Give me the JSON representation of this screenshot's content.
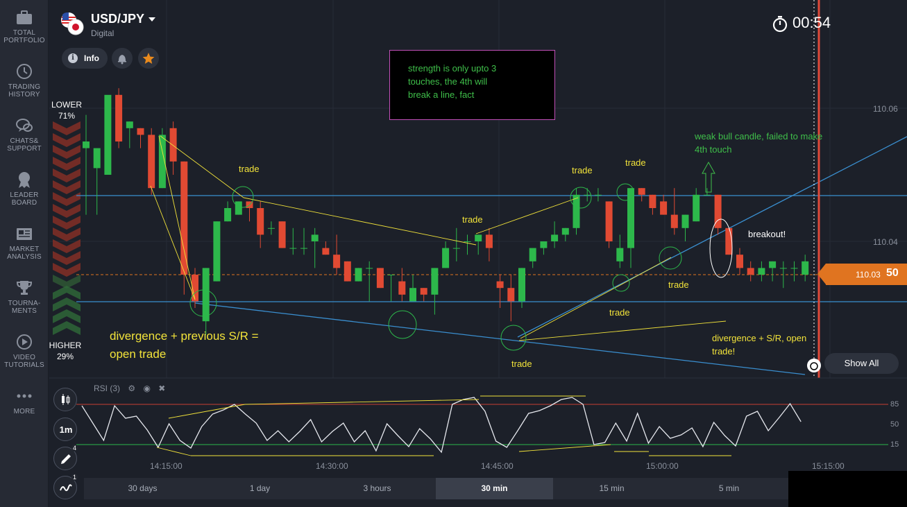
{
  "asset": {
    "name": "USD/JPY",
    "type": "Digital"
  },
  "info_label": "Info",
  "timer": "00:54",
  "sidebar": [
    {
      "label": "TOTAL\nPORTFOLIO",
      "icon": "briefcase-icon"
    },
    {
      "label": "TRADING\nHISTORY",
      "icon": "history-icon"
    },
    {
      "label": "CHATS&\nSUPPORT",
      "icon": "chat-icon"
    },
    {
      "label": "LEADER\nBOARD",
      "icon": "medal-icon"
    },
    {
      "label": "MARKET\nANALYSIS",
      "icon": "newspaper-icon"
    },
    {
      "label": "TOURNA-\nMENTS",
      "icon": "trophy-icon"
    },
    {
      "label": "VIDEO\nTUTORIALS",
      "icon": "play-icon"
    },
    {
      "label": "MORE",
      "icon": "more-dots-icon"
    }
  ],
  "sentiment": {
    "lower_label": "LOWER",
    "lower_pct": "71%",
    "higher_label": "HIGHER",
    "higher_pct": "29%"
  },
  "y_axis": [
    "110.06",
    "110.04"
  ],
  "current_price": {
    "main": "110.03",
    "emph": "50"
  },
  "x_axis": [
    "14:15:00",
    "14:30:00",
    "14:45:00",
    "15:00:00",
    "15:15:00"
  ],
  "rsi": {
    "label": "RSI (3)",
    "levels": [
      "85",
      "50",
      "15"
    ]
  },
  "tools": [
    {
      "text": "",
      "icon": "candles-icon",
      "badge": ""
    },
    {
      "text": "1m",
      "icon": "",
      "badge": ""
    },
    {
      "text": "",
      "icon": "pencil-icon",
      "badge": "4"
    },
    {
      "text": "",
      "icon": "wave-icon",
      "badge": "1"
    }
  ],
  "show_all": "Show All",
  "timeframes": [
    "30 days",
    "1 day",
    "3 hours",
    "30 min",
    "15 min",
    "5 min"
  ],
  "active_timeframe": "30 min",
  "note": "strength is only upto 3\ntouches, the 4th will\nbreak a line, fact",
  "annotations": {
    "trade1": "trade",
    "trade2": "trade",
    "trade3": "trade",
    "trade4": "trade",
    "trade5": "trade",
    "trade6": "trade",
    "trade7": "trade",
    "trade8": "trade",
    "divergence_big": "divergence + previous S/R =\nopen trade",
    "weak_bull": "weak bull candle, failed to make\n4th touch",
    "breakout": "breakout!",
    "divergence_small": "divergence + S/R, open\ntrade!"
  },
  "colors": {
    "bull": "#2db84b",
    "bear": "#e14a33",
    "level_line": "#3a8fd0",
    "trend_line": "#f2e33a",
    "orange": "#e07420",
    "red_line": "#e04a3a"
  },
  "chart_data": {
    "type": "candlestick",
    "candles": [
      {
        "o": 110.054,
        "h": 110.059,
        "l": 110.044,
        "c": 110.055
      },
      {
        "o": 110.051,
        "h": 110.052,
        "l": 110.044,
        "c": 110.054
      },
      {
        "o": 110.05,
        "h": 110.061,
        "l": 110.052,
        "c": 110.062
      },
      {
        "o": 110.062,
        "h": 110.063,
        "l": 110.054,
        "c": 110.055
      },
      {
        "o": 110.057,
        "h": 110.058,
        "l": 110.054,
        "c": 110.058
      },
      {
        "o": 110.057,
        "h": 110.057,
        "l": 110.054,
        "c": 110.056
      },
      {
        "o": 110.056,
        "h": 110.057,
        "l": 110.047,
        "c": 110.048
      },
      {
        "o": 110.048,
        "h": 110.057,
        "l": 110.048,
        "c": 110.056
      },
      {
        "o": 110.057,
        "h": 110.058,
        "l": 110.05,
        "c": 110.052
      },
      {
        "o": 110.052,
        "h": 110.052,
        "l": 110.032,
        "c": 110.035
      },
      {
        "o": 110.035,
        "h": 110.036,
        "l": 110.03,
        "c": 110.031
      },
      {
        "o": 110.028,
        "h": 110.036,
        "l": 110.026,
        "c": 110.036
      },
      {
        "o": 110.034,
        "h": 110.043,
        "l": 110.034,
        "c": 110.043
      },
      {
        "o": 110.043,
        "h": 110.046,
        "l": 110.043,
        "c": 110.045
      },
      {
        "o": 110.044,
        "h": 110.046,
        "l": 110.044,
        "c": 110.046
      },
      {
        "o": 110.046,
        "h": 110.046,
        "l": 110.043,
        "c": 110.045
      },
      {
        "o": 110.045,
        "h": 110.046,
        "l": 110.039,
        "c": 110.041
      },
      {
        "o": 110.042,
        "h": 110.043,
        "l": 110.041,
        "c": 110.042
      },
      {
        "o": 110.043,
        "h": 110.043,
        "l": 110.039,
        "c": 110.039
      },
      {
        "o": 110.039,
        "h": 110.042,
        "l": 110.038,
        "c": 110.039
      },
      {
        "o": 110.039,
        "h": 110.042,
        "l": 110.038,
        "c": 110.039
      },
      {
        "o": 110.04,
        "h": 110.042,
        "l": 110.036,
        "c": 110.041
      },
      {
        "o": 110.039,
        "h": 110.04,
        "l": 110.038,
        "c": 110.038
      },
      {
        "o": 110.038,
        "h": 110.041,
        "l": 110.035,
        "c": 110.036
      },
      {
        "o": 110.037,
        "h": 110.037,
        "l": 110.034,
        "c": 110.034
      },
      {
        "o": 110.034,
        "h": 110.036,
        "l": 110.034,
        "c": 110.036
      },
      {
        "o": 110.036,
        "h": 110.037,
        "l": 110.031,
        "c": 110.036
      },
      {
        "o": 110.036,
        "h": 110.036,
        "l": 110.033,
        "c": 110.033
      },
      {
        "o": 110.035,
        "h": 110.035,
        "l": 110.031,
        "c": 110.035
      },
      {
        "o": 110.034,
        "h": 110.036,
        "l": 110.031,
        "c": 110.032
      },
      {
        "o": 110.031,
        "h": 110.035,
        "l": 110.033,
        "c": 110.033
      },
      {
        "o": 110.033,
        "h": 110.033,
        "l": 110.031,
        "c": 110.032
      },
      {
        "o": 110.032,
        "h": 110.036,
        "l": 110.029,
        "c": 110.036
      },
      {
        "o": 110.036,
        "h": 110.04,
        "l": 110.036,
        "c": 110.039
      },
      {
        "o": 110.039,
        "h": 110.042,
        "l": 110.037,
        "c": 110.039
      },
      {
        "o": 110.04,
        "h": 110.041,
        "l": 110.038,
        "c": 110.04
      },
      {
        "o": 110.04,
        "h": 110.041,
        "l": 110.038,
        "c": 110.041
      },
      {
        "o": 110.041,
        "h": 110.042,
        "l": 110.037,
        "c": 110.039
      },
      {
        "o": 110.034,
        "h": 110.035,
        "l": 110.03,
        "c": 110.033
      },
      {
        "o": 110.033,
        "h": 110.035,
        "l": 110.028,
        "c": 110.031
      },
      {
        "o": 110.031,
        "h": 110.036,
        "l": 110.03,
        "c": 110.036
      },
      {
        "o": 110.037,
        "h": 110.038,
        "l": 110.036,
        "c": 110.039
      },
      {
        "o": 110.039,
        "h": 110.04,
        "l": 110.038,
        "c": 110.04
      },
      {
        "o": 110.04,
        "h": 110.043,
        "l": 110.039,
        "c": 110.041
      },
      {
        "o": 110.041,
        "h": 110.042,
        "l": 110.04,
        "c": 110.042
      },
      {
        "o": 110.042,
        "h": 110.048,
        "l": 110.041,
        "c": 110.047
      },
      {
        "o": 110.047,
        "h": 110.048,
        "l": 110.046,
        "c": 110.047
      },
      {
        "o": 110.047,
        "h": 110.048,
        "l": 110.046,
        "c": 110.047
      },
      {
        "o": 110.046,
        "h": 110.046,
        "l": 110.039,
        "c": 110.04
      },
      {
        "o": 110.037,
        "h": 110.041,
        "l": 110.036,
        "c": 110.039
      },
      {
        "o": 110.039,
        "h": 110.048,
        "l": 110.036,
        "c": 110.048
      },
      {
        "o": 110.048,
        "h": 110.048,
        "l": 110.046,
        "c": 110.047
      },
      {
        "o": 110.047,
        "h": 110.047,
        "l": 110.044,
        "c": 110.045
      },
      {
        "o": 110.046,
        "h": 110.047,
        "l": 110.044,
        "c": 110.044
      },
      {
        "o": 110.044,
        "h": 110.048,
        "l": 110.041,
        "c": 110.042
      },
      {
        "o": 110.042,
        "h": 110.044,
        "l": 110.04,
        "c": 110.044
      },
      {
        "o": 110.043,
        "h": 110.048,
        "l": 110.043,
        "c": 110.047
      },
      {
        "o": 110.047,
        "h": 110.048,
        "l": 110.047,
        "c": 110.047
      },
      {
        "o": 110.047,
        "h": 110.047,
        "l": 110.041,
        "c": 110.042
      },
      {
        "o": 110.042,
        "h": 110.042,
        "l": 110.038,
        "c": 110.038
      },
      {
        "o": 110.038,
        "h": 110.039,
        "l": 110.035,
        "c": 110.036
      },
      {
        "o": 110.036,
        "h": 110.037,
        "l": 110.034,
        "c": 110.035
      },
      {
        "o": 110.035,
        "h": 110.037,
        "l": 110.034,
        "c": 110.036
      },
      {
        "o": 110.036,
        "h": 110.037,
        "l": 110.034,
        "c": 110.037
      },
      {
        "o": 110.036,
        "h": 110.037,
        "l": 110.033,
        "c": 110.036
      },
      {
        "o": 110.036,
        "h": 110.037,
        "l": 110.034,
        "c": 110.036
      },
      {
        "o": 110.035,
        "h": 110.038,
        "l": 110.034,
        "c": 110.037
      }
    ]
  }
}
